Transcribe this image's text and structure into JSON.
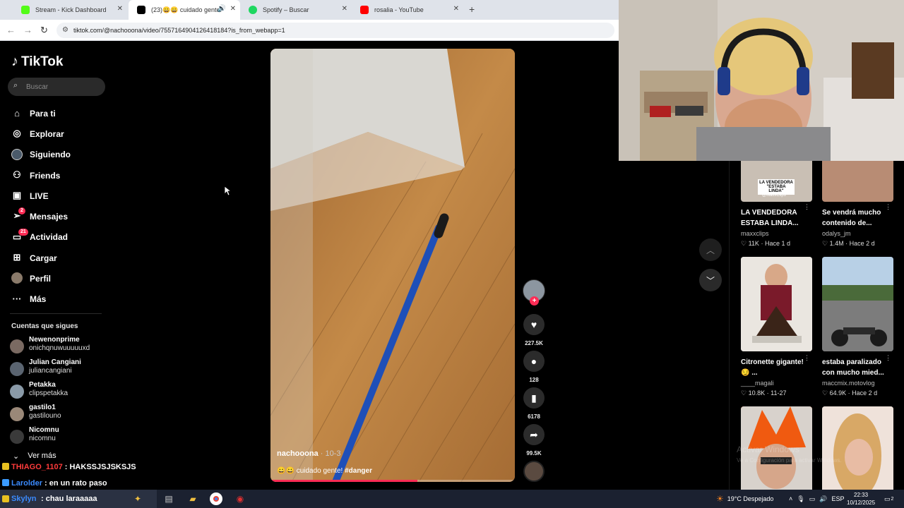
{
  "browser": {
    "tabs": [
      {
        "label": "Stream - Kick Dashboard",
        "favicon_color": "#53fc18",
        "active": false
      },
      {
        "label": "(23)😀😀 cuidado gente! #",
        "favicon_color": "#000000",
        "active": true
      },
      {
        "label": "Spotify – Buscar",
        "favicon_color": "#1ed760",
        "active": false
      },
      {
        "label": "rosalia - YouTube",
        "favicon_color": "#ff0000",
        "active": false
      }
    ],
    "url": "tiktok.com/@nachooona/video/7557164904126418184?is_from_webapp=1"
  },
  "tiktok": {
    "logo": "TikTok",
    "search_placeholder": "Buscar",
    "nav": [
      {
        "label": "Para ti",
        "icon": "home-icon"
      },
      {
        "label": "Explorar",
        "icon": "compass-icon"
      },
      {
        "label": "Siguiendo",
        "icon": "following-icon"
      },
      {
        "label": "Friends",
        "icon": "friends-icon"
      },
      {
        "label": "LIVE",
        "icon": "live-icon"
      },
      {
        "label": "Mensajes",
        "icon": "messages-icon",
        "badge": "2"
      },
      {
        "label": "Actividad",
        "icon": "activity-icon",
        "badge": "21"
      },
      {
        "label": "Cargar",
        "icon": "upload-icon"
      },
      {
        "label": "Perfil",
        "icon": "profile-icon"
      },
      {
        "label": "Más",
        "icon": "more-icon"
      }
    ],
    "following_title": "Cuentas que sigues",
    "following": [
      {
        "name": "Newenonprime",
        "handle": "onichqnuwuuuuuxd"
      },
      {
        "name": "Julian Cangiani",
        "handle": "juliancangiani"
      },
      {
        "name": "Petakka",
        "handle": "clipspetakka"
      },
      {
        "name": "gastilo1",
        "handle": "gastilouno"
      },
      {
        "name": "Nicomnu",
        "handle": "nicomnu"
      }
    ],
    "see_more": "Ver más",
    "video": {
      "author": "nachooona",
      "date": " · 10-3",
      "caption_emoji": "😀😀",
      "caption_text": "cuidado gente!",
      "caption_tag": "#danger",
      "progress": 0.6
    },
    "actions": {
      "likes": "227.5K",
      "comments": "128",
      "saves": "6178",
      "shares": "99.5K"
    },
    "recommendations": [
      {
        "title": "LA VENDEDORA ESTABA LINDA...",
        "author": "maxxclips",
        "likes": "11K",
        "time": "Hace 1 d",
        "overlay": "LA VENDEDORA \"ESTABA LINDA\"",
        "watermark": "@MaxxClips"
      },
      {
        "title": "Se vendrá mucho contenido de...",
        "author": "odalys_jm",
        "likes": "1.4M",
        "time": "Hace 2 d"
      },
      {
        "title": "Citronette gigante!😏 ...",
        "author": "____magali",
        "likes": "10.8K",
        "time": "11-27"
      },
      {
        "title": "estaba paralizado con mucho mied...",
        "author": "maccmix.motovlog",
        "likes": "64.9K",
        "time": "Hace 2 d"
      },
      {
        "title": "",
        "author": "",
        "likes": "",
        "time": ""
      },
      {
        "title": "",
        "author": "",
        "likes": "",
        "time": ""
      }
    ],
    "windows_watermark_1": "Activar Windows",
    "windows_watermark_2": "Ve a Configuración para activar Windows."
  },
  "chat": [
    {
      "user": "THIAGO_1107",
      "message": ": HAKSSJSJSKSJS",
      "user_color": "#ff3b3b",
      "badge_color": "#e8c020"
    },
    {
      "user": "Larolder",
      "message": ": en un rato paso",
      "user_color": "#3b8bff",
      "badge_color": "#3b9bff"
    },
    {
      "user": "Skylyn",
      "message": ": chau laraaaaa",
      "user_color": "#3b8bff",
      "badge_color": "#e8c020"
    }
  ],
  "taskbar": {
    "search_placeholder": "Búsqueda",
    "weather": "19°C  Despejado",
    "lang": "ESP",
    "time": "22:33",
    "date": "10/12/2025",
    "notifications": "2"
  }
}
